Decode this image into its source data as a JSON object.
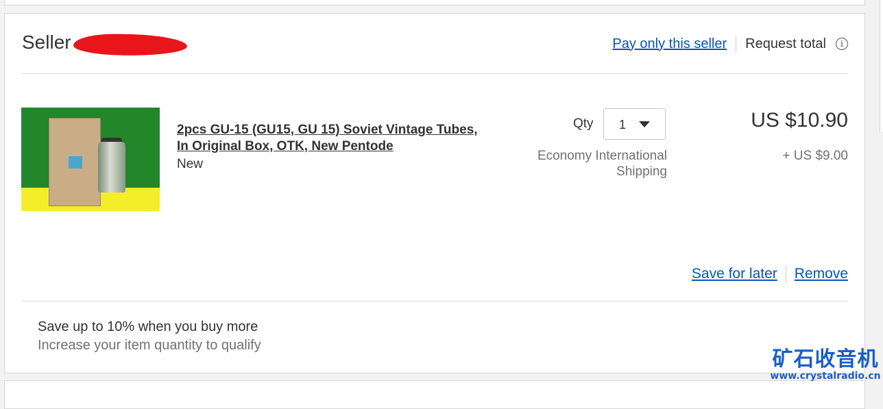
{
  "seller": {
    "label": "Seller",
    "pay_only_label": "Pay only this seller",
    "request_total_label": "Request total",
    "info_icon": "info-icon"
  },
  "item": {
    "title": "2pcs GU-15 (GU15, GU 15) Soviet Vintage Tubes, In Original Box, OTK, New Pentode",
    "condition": "New",
    "qty_label": "Qty",
    "qty_value": "1",
    "shipping_method": "Economy International Shipping",
    "price": "US $10.90",
    "shipping_price": "+ US $9.00",
    "save_for_later_label": "Save for later",
    "remove_label": "Remove"
  },
  "promo": {
    "title": "Save up to 10% when you buy more",
    "subtitle": "Increase your item quantity to qualify"
  },
  "watermark": {
    "site_name": "矿石收音机",
    "url": "www.crystalradio.cn"
  },
  "colors": {
    "link": "#0654ba",
    "redaction": "#e8161b",
    "watermark": "#1a5fc4"
  }
}
